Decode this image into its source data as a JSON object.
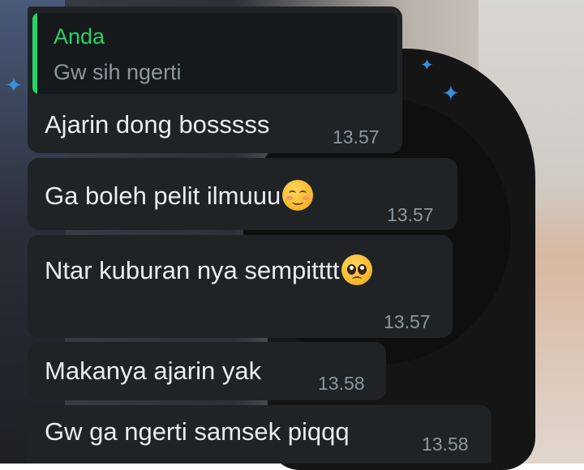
{
  "chat": {
    "messages": [
      {
        "quote": {
          "author": "Anda",
          "text": "Gw sih ngerti"
        },
        "text": "Ajarin dong bosssss",
        "time": "13.57"
      },
      {
        "text": "Ga boleh pelit ilmuuu",
        "emoji": "relieved-face",
        "time": "13.57"
      },
      {
        "text": "Ntar kuburan nya sempitttt",
        "emoji": "pleading-face",
        "time": "13.57"
      },
      {
        "text": "Makanya ajarin yak",
        "time": "13.58"
      },
      {
        "text": "Gw ga ngerti samsek piqqq",
        "time": "13.58"
      }
    ],
    "colors": {
      "bubble": "#1f2326",
      "text": "#e9edef",
      "time": "#8b979e",
      "quote_author": "#25d366"
    }
  }
}
